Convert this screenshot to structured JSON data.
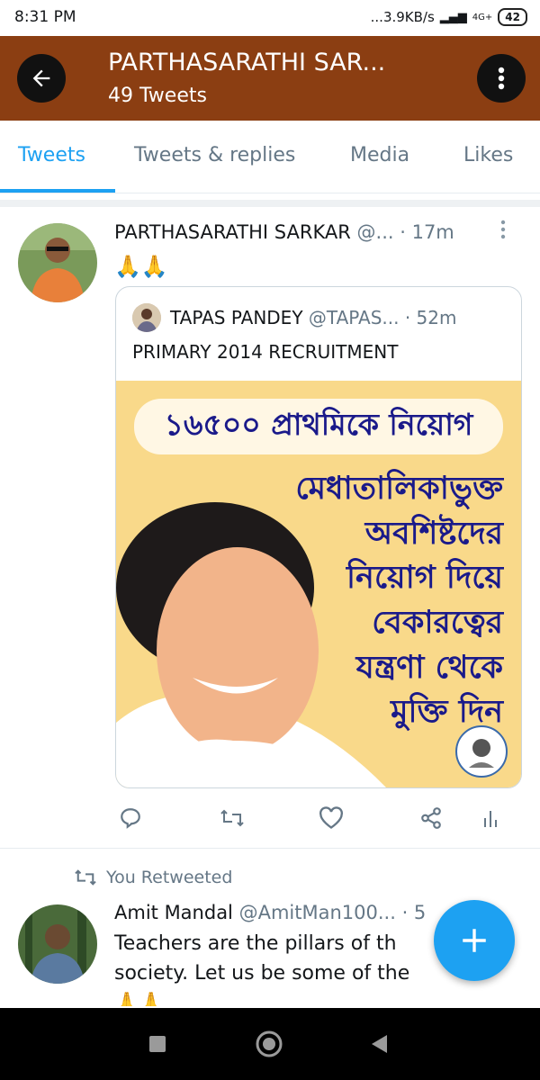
{
  "status_bar": {
    "time": "8:31 PM",
    "network_speed": "...3.9KB/s",
    "network": "4G+",
    "battery": "42"
  },
  "header": {
    "title": "PARTHASARATHI SAR...",
    "subtitle": "49 Tweets",
    "back_icon": "arrow-left-icon",
    "more_icon": "more-vertical-icon"
  },
  "tabs": [
    {
      "label": "Tweets",
      "active": true
    },
    {
      "label": "Tweets & replies",
      "active": false
    },
    {
      "label": "Media",
      "active": false
    },
    {
      "label": "Likes",
      "active": false
    }
  ],
  "tweet1": {
    "author": "PARTHASARATHI SARKAR",
    "handle": "@...",
    "time": "· 17m",
    "text": "🙏🙏",
    "quoted": {
      "author": "TAPAS PANDEY",
      "handle": "@TAPAS...",
      "time": "· 52m",
      "text": "PRIMARY 2014 RECRUITMENT",
      "image": {
        "headline": "১৬৫০০ প্রাথমিকে নিয়োগ",
        "lines": [
          "মেধাতালিকাভুক্ত",
          "অবশিষ্টদের",
          "নিয়োগ দিয়ে",
          "বেকারত্বের",
          "যন্ত্রণা থেকে",
          "মুক্তি দিন"
        ]
      }
    }
  },
  "tweet2": {
    "retweet_label": "You Retweeted",
    "author": "Amit Mandal",
    "handle": "@AmitMan100...",
    "time": "· 5",
    "lines": [
      "Teachers are the pillars of th",
      "society. Let us be some of the"
    ],
    "emoji": "🙏🙏"
  },
  "colors": {
    "header_bg": "#8b3e12",
    "accent": "#1da1f2",
    "fab": "#1da1f2"
  }
}
